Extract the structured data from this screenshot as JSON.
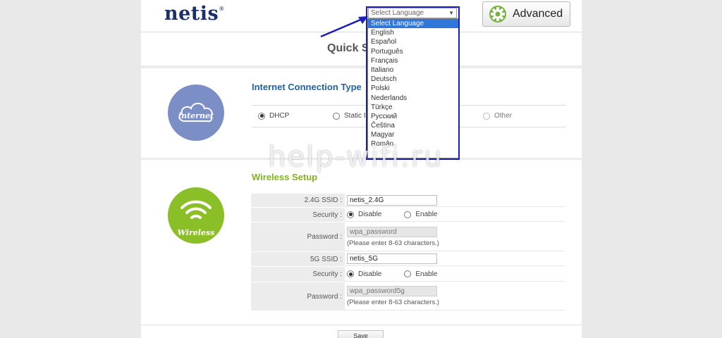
{
  "brand": {
    "logo": "netis",
    "logo_mark": "®"
  },
  "header": {
    "advanced_label": "Advanced"
  },
  "page": {
    "title": "Quick S"
  },
  "language": {
    "selected": "Select Language",
    "options": [
      "Select Language",
      "English",
      "Español",
      "Português",
      "Français",
      "Italiano",
      "Deutsch",
      "Polski",
      "Nederlands",
      "Türkçe",
      "Русский",
      "Čeština",
      "Magyar",
      "Român"
    ]
  },
  "internet": {
    "icon_label": "internet",
    "section_title": "Internet Connection Type",
    "options": {
      "dhcp": "DHCP",
      "static": "Static IP",
      "other": "Other"
    },
    "selected": "DHCP"
  },
  "wireless": {
    "icon_label": "Wireless",
    "section_title": "Wireless Setup",
    "ssid24_label": "2.4G SSID :",
    "ssid24_value": "netis_2.4G",
    "security_label": "Security :",
    "disable_label": "Disable",
    "enable_label": "Enable",
    "password_label": "Password :",
    "password24_value": "wpa_password",
    "password_hint": "(Please enter 8-63 characters.)",
    "ssid5_label": "5G SSID :",
    "ssid5_value": "netis_5G",
    "password5_value": "wpa_password5g"
  },
  "actions": {
    "save_label": "Save"
  },
  "watermark": "help-wifi.ru",
  "colors": {
    "internet_circle": "#7b8fc6",
    "wireless_circle": "#8bbf27",
    "section_blue": "#2063a6",
    "section_green": "#7fb51d",
    "highlight_frame": "#1a1fb5"
  }
}
